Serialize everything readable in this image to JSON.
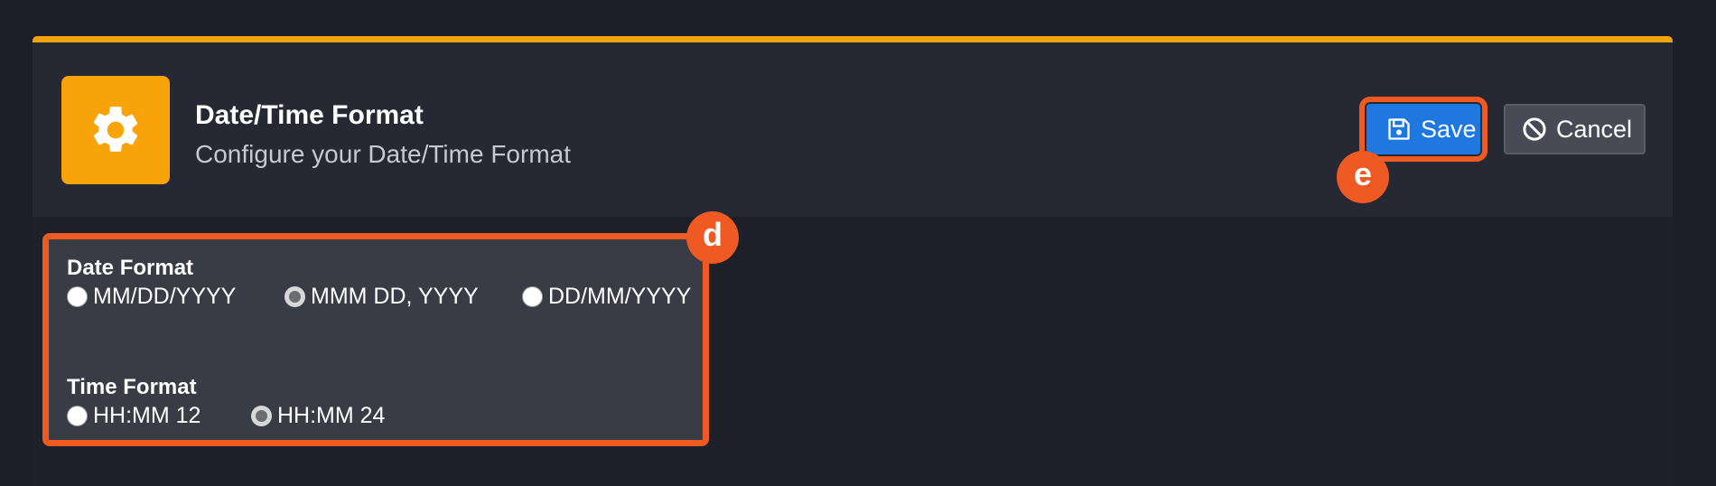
{
  "header": {
    "icon": "gear-icon",
    "title": "Date/Time Format",
    "subtitle": "Configure your Date/Time Format"
  },
  "actions": {
    "save_label": "Save",
    "save_icon": "floppy-disk-icon",
    "cancel_label": "Cancel",
    "cancel_icon": "ban-icon"
  },
  "markers": {
    "save": "e",
    "form": "d"
  },
  "date_format": {
    "label": "Date Format",
    "options": [
      {
        "label": "MM/DD/YYYY",
        "checked": false
      },
      {
        "label": "MMM DD, YYYY",
        "checked": true
      },
      {
        "label": "DD/MM/YYYY",
        "checked": false
      }
    ]
  },
  "time_format": {
    "label": "Time Format",
    "options": [
      {
        "label": "HH:MM 12",
        "checked": false
      },
      {
        "label": "HH:MM 24",
        "checked": true
      }
    ]
  },
  "colors": {
    "accent": "#f5a30a",
    "primary": "#1e78e0",
    "annotation": "#ef5a23",
    "background": "#1c1f29"
  }
}
